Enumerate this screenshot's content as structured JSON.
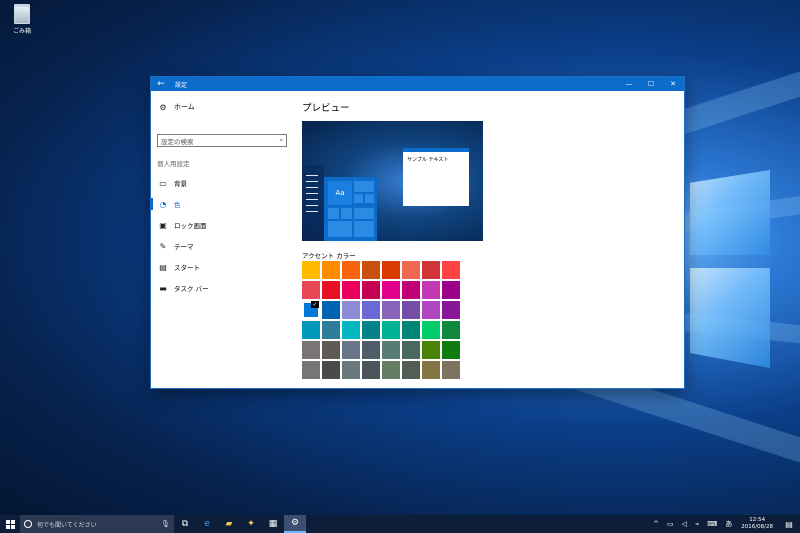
{
  "desktop": {
    "recycle_bin_label": "ごみ箱"
  },
  "window": {
    "title": "設定",
    "controls": {
      "minimize": "—",
      "maximize": "☐",
      "close": "✕"
    }
  },
  "sidebar": {
    "home_label": "ホーム",
    "search_placeholder": "設定の検索",
    "section_label": "個人用設定",
    "items": [
      {
        "label": "背景",
        "icon": "picture-icon"
      },
      {
        "label": "色",
        "icon": "palette-icon"
      },
      {
        "label": "ロック画面",
        "icon": "lockscreen-icon"
      },
      {
        "label": "テーマ",
        "icon": "theme-icon"
      },
      {
        "label": "スタート",
        "icon": "start-icon"
      },
      {
        "label": "タスク バー",
        "icon": "taskbar-icon"
      }
    ]
  },
  "main": {
    "title": "プレビュー",
    "preview": {
      "tile_text": "Aa",
      "sample_text": "サンプル テキスト"
    },
    "accent_label": "アクセント カラー",
    "selected_color": "#0063B1",
    "colors": [
      "#FFB900",
      "#FF8C00",
      "#F7630C",
      "#CA5010",
      "#DA3B01",
      "#EF6950",
      "#D13438",
      "#FF4343",
      "#E74856",
      "#E81123",
      "#EA005E",
      "#C30052",
      "#E3008C",
      "#BF0077",
      "#C239B3",
      "#9A0089",
      "#0078D7",
      "#0063B1",
      "#8E8CD8",
      "#6B69D6",
      "#8764B8",
      "#744DA9",
      "#B146C2",
      "#881798",
      "#0099BC",
      "#2D7D9A",
      "#00B7C3",
      "#038387",
      "#00B294",
      "#018574",
      "#00CC6A",
      "#10893E",
      "#7A7574",
      "#5D5A58",
      "#68768A",
      "#515C6B",
      "#567C73",
      "#486860",
      "#498205",
      "#107C10",
      "#767676",
      "#4C4A48",
      "#69797E",
      "#4A5459",
      "#647C64",
      "#525E54",
      "#847545",
      "#7E735F"
    ],
    "selected_index": 16
  },
  "taskbar": {
    "search_placeholder": "何でも聞いてください",
    "clock_time": "12:54",
    "clock_date": "2016/08/28",
    "tray_language": "あ"
  }
}
